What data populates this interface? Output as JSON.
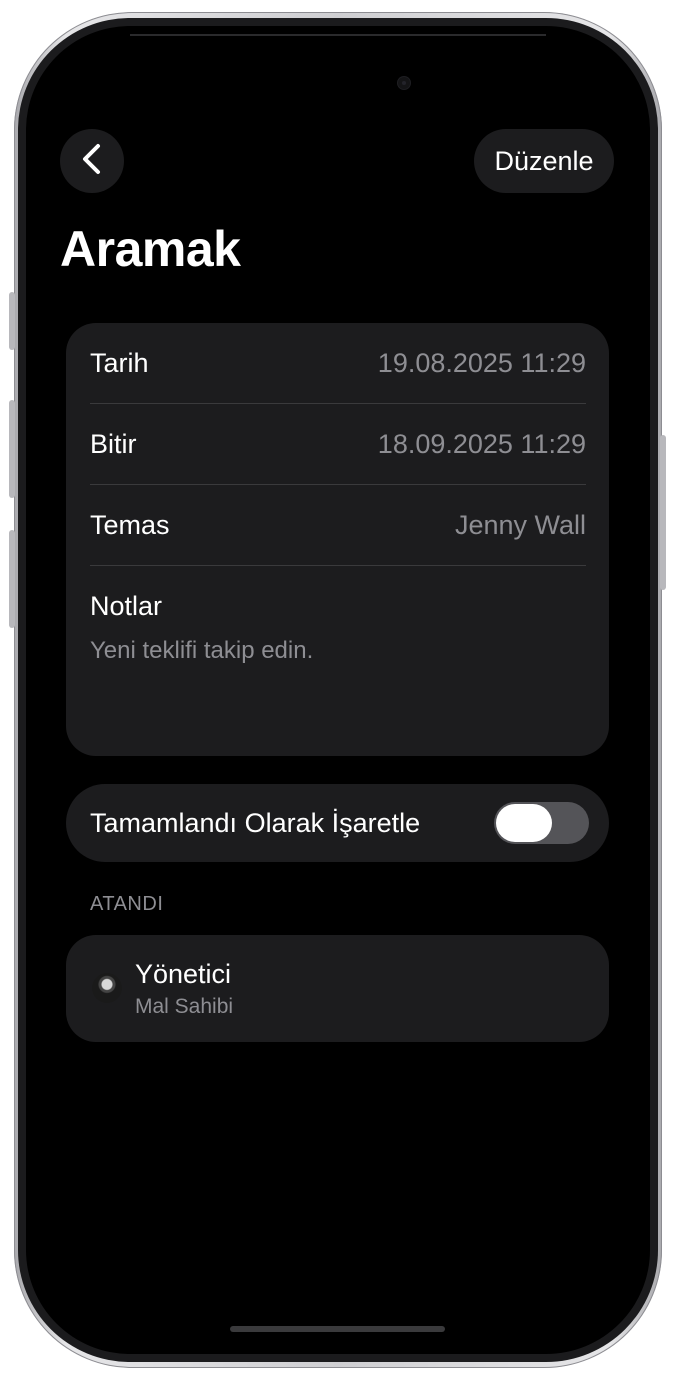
{
  "header": {
    "edit_label": "Düzenle",
    "title": "Aramak"
  },
  "details": {
    "rows": [
      {
        "label": "Tarih",
        "value": "19.08.2025 11:29"
      },
      {
        "label": "Bitir",
        "value": "18.09.2025 11:29"
      },
      {
        "label": "Temas",
        "value": "Jenny Wall"
      }
    ],
    "notes_label": "Notlar",
    "notes_text": "Yeni teklifi takip edin."
  },
  "complete_toggle": {
    "label": "Tamamlandı Olarak İşaretle",
    "on": false
  },
  "assigned": {
    "header": "ATANDI",
    "name": "Yönetici",
    "role": "Mal Sahibi"
  },
  "colors": {
    "background": "#000000",
    "card": "#1c1c1e",
    "secondary_text": "#8e8e93",
    "toggle_off": "#545458"
  },
  "icons": {
    "back": "chevron-left-icon"
  }
}
